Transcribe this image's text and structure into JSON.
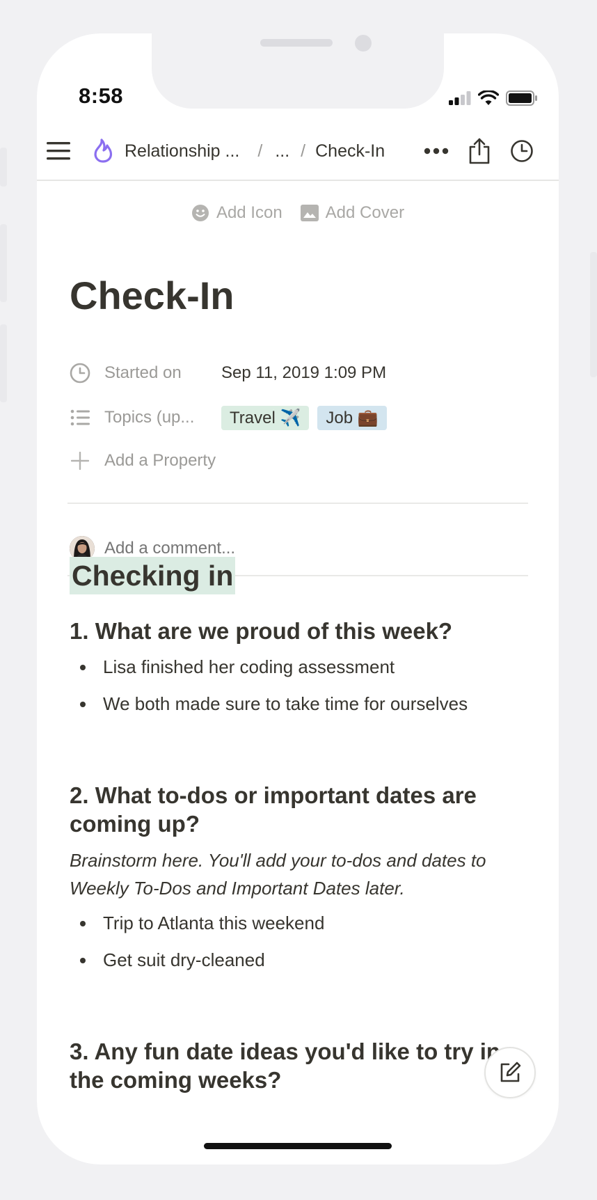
{
  "status_bar": {
    "time": "8:58"
  },
  "breadcrumb": {
    "workspace": "Relationship ...",
    "ellipsis": "...",
    "current": "Check-In",
    "separator": "/"
  },
  "page_actions": {
    "add_icon": "Add Icon",
    "add_cover": "Add Cover"
  },
  "page": {
    "title": "Check-In",
    "properties": [
      {
        "icon": "clock-icon",
        "label": "Started on",
        "value": "Sep 11, 2019 1:09 PM"
      },
      {
        "icon": "list-icon",
        "label": "Topics (up...",
        "tags": [
          {
            "label": "Travel ✈️",
            "color": "#dbede2"
          },
          {
            "label": "Job 💼",
            "color": "#d3e5ef"
          }
        ]
      }
    ],
    "add_property": "Add a Property",
    "comment_placeholder": "Add a comment..."
  },
  "body": {
    "heading": "Checking in",
    "section1": {
      "title": "1. What are we proud of this week?",
      "bullets": [
        "Lisa finished her coding assessment",
        "We both made sure to take time for ourselves"
      ]
    },
    "section2": {
      "title": "2. What to-dos or important dates are coming up?",
      "note": "Brainstorm here. You'll add your to-dos and dates to Weekly To-Dos and Important Dates later.",
      "bullets": [
        "Trip to Atlanta this weekend",
        "Get suit dry-cleaned"
      ]
    },
    "section3": {
      "title": "3. Any fun date ideas you'd like to try in the coming weeks?"
    }
  },
  "colors": {
    "accent_icon": "#8b6ff0",
    "heading_highlight": "#dbece3",
    "text": "#37352f",
    "muted": "#9b9a97"
  }
}
